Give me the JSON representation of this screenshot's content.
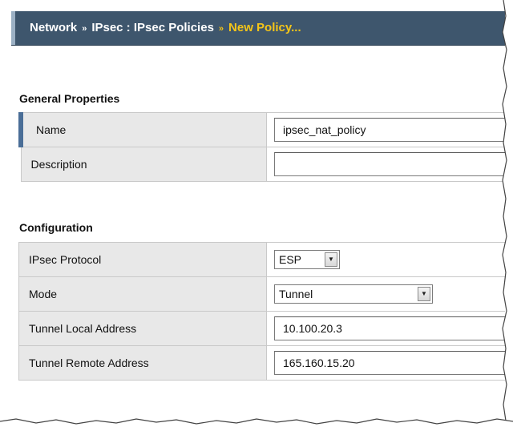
{
  "breadcrumb": {
    "items": [
      "Network",
      "IPsec : IPsec Policies",
      "New Policy..."
    ],
    "separator": "»"
  },
  "general": {
    "title": "General Properties",
    "rows": [
      {
        "label": "Name",
        "value": "ipsec_nat_policy"
      },
      {
        "label": "Description",
        "value": ""
      }
    ]
  },
  "configuration": {
    "title": "Configuration",
    "rows": [
      {
        "label": "IPsec Protocol",
        "value": "ESP"
      },
      {
        "label": "Mode",
        "value": "Tunnel"
      },
      {
        "label": "Tunnel Local Address",
        "value": "10.100.20.3"
      },
      {
        "label": "Tunnel Remote Address",
        "value": "165.160.15.20"
      }
    ]
  },
  "colors": {
    "header_bg": "#3e566d",
    "breadcrumb_current": "#f5c518",
    "label_bg": "#e8e8e8",
    "active_row_marker": "#4a6e97"
  }
}
